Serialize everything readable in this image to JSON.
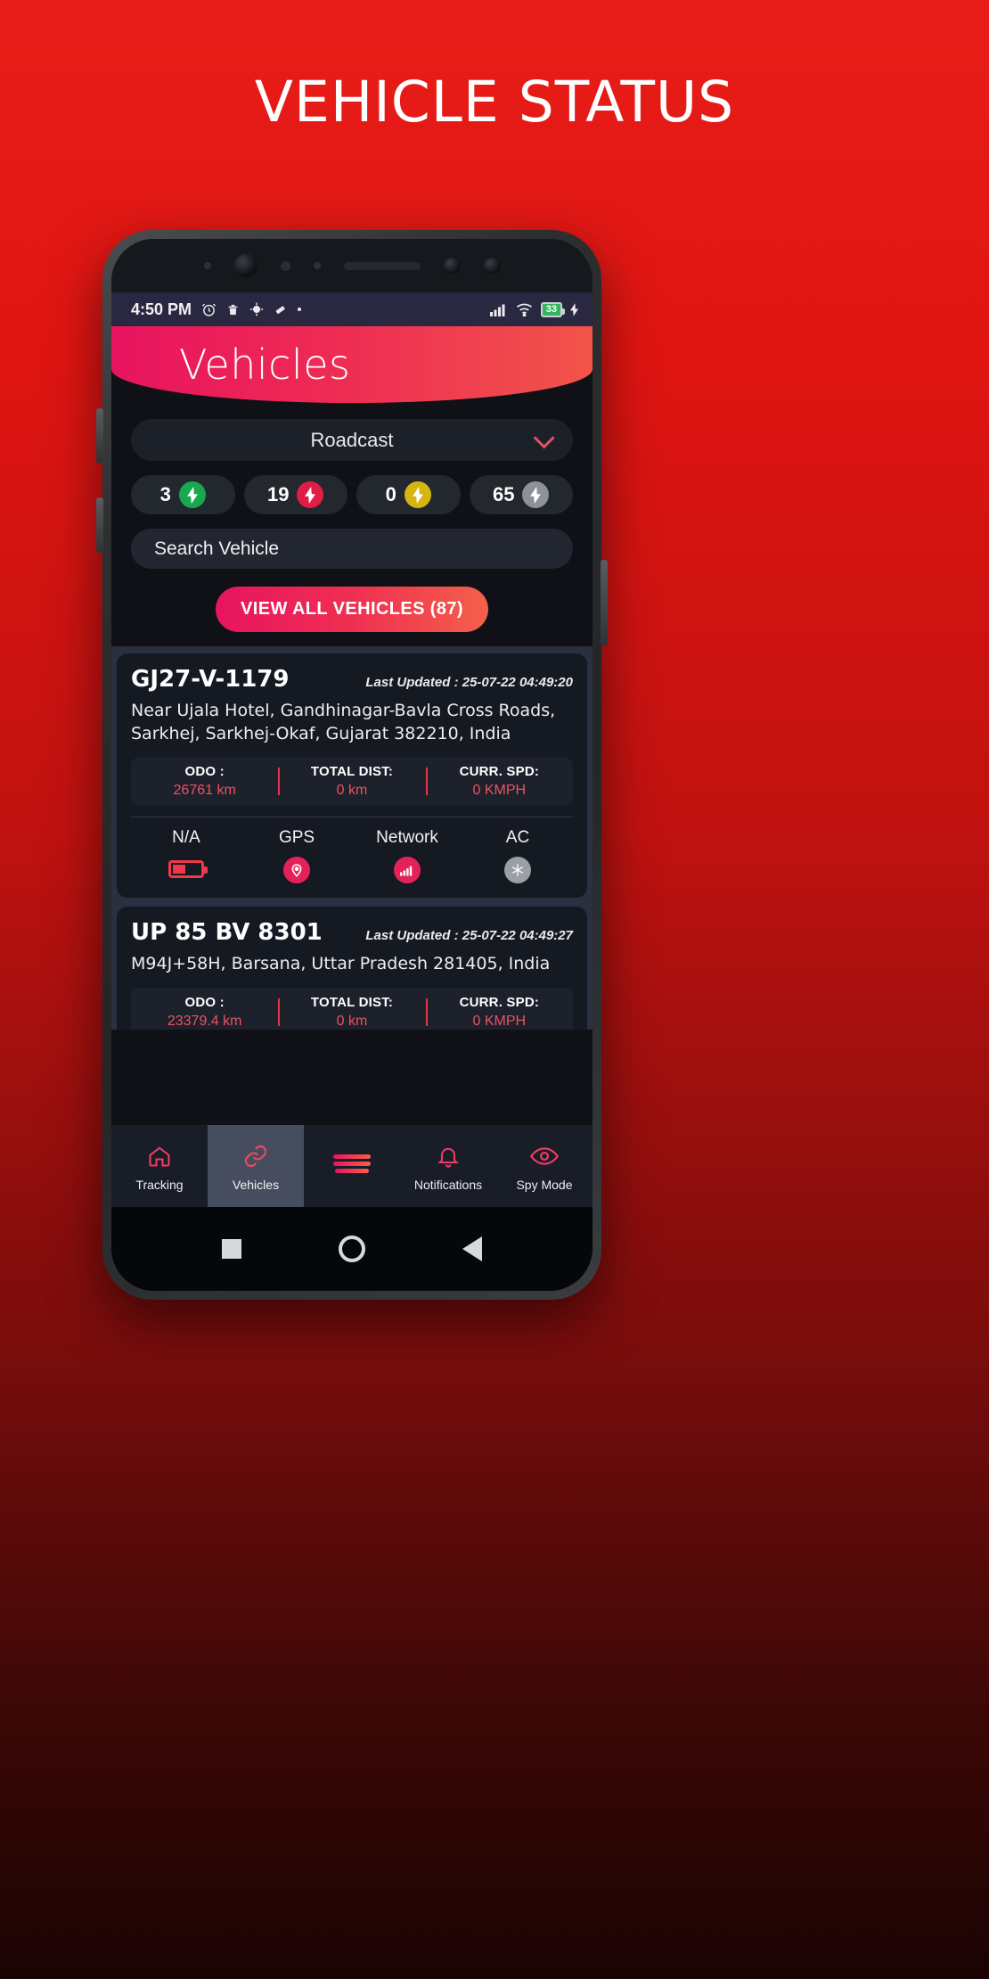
{
  "poster": {
    "title": "VEHICLE STATUS",
    "background_accent": "#e01512"
  },
  "status_bar": {
    "time": "4:50 PM",
    "icons_left": [
      "alarm-icon",
      "trash-icon",
      "location-icon",
      "eraser-icon",
      "dot-icon"
    ],
    "signal": "signal-icon",
    "wifi": "wifi-icon",
    "battery_level": "33",
    "charging": "charging-bolt-icon"
  },
  "app_header": {
    "title": "Vehicles",
    "gradient_from": "#e8145f",
    "gradient_to": "#f2544a"
  },
  "filter": {
    "selected": "Roadcast",
    "chevron": "chevron-down-icon"
  },
  "status_chips": [
    {
      "count": "3",
      "color": "#18a94e",
      "icon": "bolt-icon",
      "name": "running"
    },
    {
      "count": "19",
      "color": "#e11d45",
      "icon": "bolt-icon",
      "name": "stopped"
    },
    {
      "count": "0",
      "color": "#d4b512",
      "icon": "bolt-icon",
      "name": "idle"
    },
    {
      "count": "65",
      "color": "#8d9299",
      "icon": "bolt-icon",
      "name": "offline"
    }
  ],
  "search": {
    "placeholder": "Search Vehicle",
    "value": "Search Vehicle"
  },
  "view_all_button": {
    "label": "VIEW ALL VEHICLES (87)"
  },
  "vehicles": [
    {
      "plate": "GJ27-V-1179",
      "last_updated": "Last Updated : 25-07-22 04:49:20",
      "address": "Near Ujala Hotel, Gandhinagar-Bavla Cross Roads, Sarkhej, Sarkhej-Okaf, Gujarat 382210, India",
      "metrics": [
        {
          "label": "ODO :",
          "value": "26761 km"
        },
        {
          "label": "TOTAL DIST:",
          "value": "0 km"
        },
        {
          "label": "CURR. SPD:",
          "value": "0 KMPH"
        }
      ],
      "statuses": [
        {
          "label": "N/A",
          "icon": "battery-icon",
          "color": "#f0394a"
        },
        {
          "label": "GPS",
          "icon": "location-icon",
          "color": "#e5215a"
        },
        {
          "label": "Network",
          "icon": "signal-icon",
          "color": "#e5215a"
        },
        {
          "label": "AC",
          "icon": "snowflake-icon",
          "color": "#9aa0a6"
        }
      ]
    },
    {
      "plate": "UP 85 BV 8301",
      "last_updated": "Last Updated : 25-07-22 04:49:27",
      "address": "M94J+58H, Barsana, Uttar Pradesh 281405, India",
      "metrics": [
        {
          "label": "ODO :",
          "value": "23379.4 km"
        },
        {
          "label": "TOTAL DIST:",
          "value": "0 km"
        },
        {
          "label": "CURR. SPD:",
          "value": "0 KMPH"
        }
      ],
      "statuses": []
    }
  ],
  "bottom_nav": [
    {
      "label": "Tracking",
      "icon": "home-icon",
      "active": false
    },
    {
      "label": "Vehicles",
      "icon": "link-icon",
      "active": true
    },
    {
      "label": "",
      "icon": "hamburger-icon",
      "active": false
    },
    {
      "label": "Notifications",
      "icon": "bell-icon",
      "active": false
    },
    {
      "label": "Spy Mode",
      "icon": "eye-icon",
      "active": false
    }
  ],
  "system_nav": [
    "square-icon",
    "circle-icon",
    "triangle-back-icon"
  ]
}
